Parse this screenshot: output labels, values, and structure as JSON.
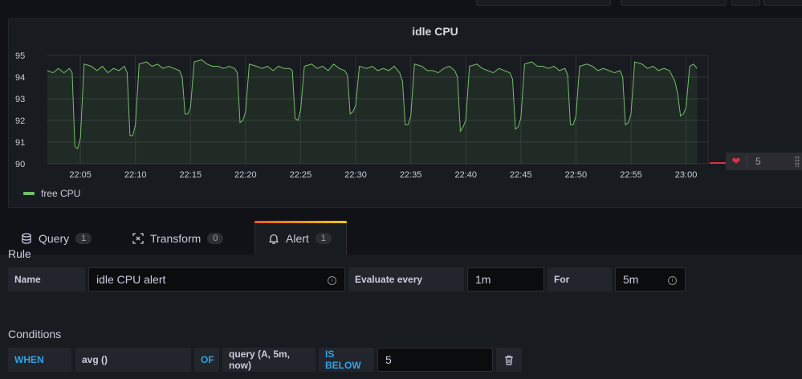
{
  "panel": {
    "title": "idle CPU",
    "legend_label": "free CPU",
    "threshold_value": "5"
  },
  "chart_data": {
    "type": "line",
    "title": "idle CPU",
    "xlabel": "",
    "ylabel": "",
    "ylim": [
      90,
      95
    ],
    "y_ticks": [
      "95",
      "94",
      "93",
      "92",
      "91",
      "90"
    ],
    "x_ticks": [
      "22:05",
      "22:10",
      "22:15",
      "22:20",
      "22:25",
      "22:30",
      "22:35",
      "22:40",
      "22:45",
      "22:50",
      "22:55",
      "23:00"
    ],
    "grid": true,
    "legend_position": "bottom-left",
    "series": [
      {
        "name": "free CPU",
        "color": "#73bf69",
        "points": [
          [
            "22:02",
            94.3
          ],
          [
            "22:02:30",
            94.2
          ],
          [
            "22:03",
            94.4
          ],
          [
            "22:03:30",
            94.2
          ],
          [
            "22:04",
            94.4
          ],
          [
            "22:04:15",
            94.2
          ],
          [
            "22:04:30",
            90.8
          ],
          [
            "22:04:45",
            90.7
          ],
          [
            "22:05",
            91.2
          ],
          [
            "22:05:20",
            94.6
          ],
          [
            "22:06",
            94.5
          ],
          [
            "22:06:30",
            94.3
          ],
          [
            "22:07",
            94.5
          ],
          [
            "22:07:30",
            94.2
          ],
          [
            "22:08",
            94.4
          ],
          [
            "22:08:30",
            94.3
          ],
          [
            "22:09",
            94.5
          ],
          [
            "22:09:15",
            94.2
          ],
          [
            "22:09:30",
            91.3
          ],
          [
            "22:09:45",
            91.3
          ],
          [
            "22:10",
            91.8
          ],
          [
            "22:10:20",
            94.6
          ],
          [
            "22:11",
            94.7
          ],
          [
            "22:11:30",
            94.5
          ],
          [
            "22:12",
            94.6
          ],
          [
            "22:12:30",
            94.4
          ],
          [
            "22:13",
            94.5
          ],
          [
            "22:13:30",
            94.4
          ],
          [
            "22:14",
            94.3
          ],
          [
            "22:14:15",
            94.0
          ],
          [
            "22:14:30",
            92.3
          ],
          [
            "22:14:45",
            92.3
          ],
          [
            "22:15",
            92.6
          ],
          [
            "22:15:20",
            94.7
          ],
          [
            "22:16",
            94.8
          ],
          [
            "22:16:30",
            94.6
          ],
          [
            "22:17",
            94.5
          ],
          [
            "22:17:30",
            94.5
          ],
          [
            "22:18",
            94.4
          ],
          [
            "22:18:30",
            94.5
          ],
          [
            "22:19",
            94.4
          ],
          [
            "22:19:15",
            94.2
          ],
          [
            "22:19:30",
            91.9
          ],
          [
            "22:19:45",
            92.0
          ],
          [
            "22:20",
            92.4
          ],
          [
            "22:20:20",
            94.6
          ],
          [
            "22:21",
            94.5
          ],
          [
            "22:21:30",
            94.4
          ],
          [
            "22:22",
            94.5
          ],
          [
            "22:22:30",
            94.3
          ],
          [
            "22:23",
            94.5
          ],
          [
            "22:23:30",
            94.4
          ],
          [
            "22:24",
            94.4
          ],
          [
            "22:24:15",
            94.3
          ],
          [
            "22:24:30",
            92.1
          ],
          [
            "22:24:45",
            92.0
          ],
          [
            "22:25",
            92.5
          ],
          [
            "22:25:20",
            94.5
          ],
          [
            "22:26",
            94.6
          ],
          [
            "22:26:30",
            94.4
          ],
          [
            "22:27",
            94.5
          ],
          [
            "22:27:30",
            94.3
          ],
          [
            "22:28",
            94.6
          ],
          [
            "22:28:30",
            94.4
          ],
          [
            "22:29",
            94.3
          ],
          [
            "22:29:15",
            94.1
          ],
          [
            "22:29:30",
            92.3
          ],
          [
            "22:29:45",
            92.4
          ],
          [
            "22:30",
            92.7
          ],
          [
            "22:30:20",
            94.5
          ],
          [
            "22:31",
            94.4
          ],
          [
            "22:31:30",
            94.5
          ],
          [
            "22:32",
            94.3
          ],
          [
            "22:32:30",
            94.4
          ],
          [
            "22:33",
            94.3
          ],
          [
            "22:33:30",
            94.5
          ],
          [
            "22:34",
            94.2
          ],
          [
            "22:34:15",
            93.8
          ],
          [
            "22:34:30",
            91.8
          ],
          [
            "22:34:45",
            91.8
          ],
          [
            "22:35",
            92.2
          ],
          [
            "22:35:20",
            94.6
          ],
          [
            "22:36",
            94.5
          ],
          [
            "22:36:30",
            94.3
          ],
          [
            "22:37",
            94.3
          ],
          [
            "22:37:30",
            94.2
          ],
          [
            "22:38",
            94.4
          ],
          [
            "22:38:30",
            94.5
          ],
          [
            "22:39",
            94.3
          ],
          [
            "22:39:15",
            94.0
          ],
          [
            "22:39:30",
            91.5
          ],
          [
            "22:39:45",
            91.7
          ],
          [
            "22:40",
            92.0
          ],
          [
            "22:40:20",
            94.5
          ],
          [
            "22:41",
            94.6
          ],
          [
            "22:41:30",
            94.4
          ],
          [
            "22:42",
            94.3
          ],
          [
            "22:42:30",
            94.2
          ],
          [
            "22:43",
            94.4
          ],
          [
            "22:43:30",
            94.3
          ],
          [
            "22:44",
            94.2
          ],
          [
            "22:44:15",
            93.9
          ],
          [
            "22:44:30",
            91.6
          ],
          [
            "22:44:45",
            91.7
          ],
          [
            "22:45",
            92.1
          ],
          [
            "22:45:20",
            94.6
          ],
          [
            "22:46",
            94.7
          ],
          [
            "22:46:30",
            94.5
          ],
          [
            "22:47",
            94.5
          ],
          [
            "22:47:30",
            94.4
          ],
          [
            "22:48",
            94.5
          ],
          [
            "22:48:30",
            94.3
          ],
          [
            "22:49",
            94.4
          ],
          [
            "22:49:15",
            94.1
          ],
          [
            "22:49:30",
            91.8
          ],
          [
            "22:49:45",
            91.8
          ],
          [
            "22:50",
            92.2
          ],
          [
            "22:50:20",
            94.5
          ],
          [
            "22:51",
            94.6
          ],
          [
            "22:51:30",
            94.5
          ],
          [
            "22:52",
            94.3
          ],
          [
            "22:52:30",
            94.4
          ],
          [
            "22:53",
            94.3
          ],
          [
            "22:53:30",
            94.2
          ],
          [
            "22:54",
            94.3
          ],
          [
            "22:54:15",
            94.0
          ],
          [
            "22:54:30",
            91.8
          ],
          [
            "22:54:45",
            91.9
          ],
          [
            "22:55",
            92.3
          ],
          [
            "22:55:20",
            94.7
          ],
          [
            "22:56",
            94.6
          ],
          [
            "22:56:30",
            94.4
          ],
          [
            "22:57",
            94.5
          ],
          [
            "22:57:30",
            94.3
          ],
          [
            "22:58",
            94.4
          ],
          [
            "22:58:30",
            94.3
          ],
          [
            "22:59",
            93.8
          ],
          [
            "22:59:15",
            93.2
          ],
          [
            "22:59:30",
            92.2
          ],
          [
            "22:59:45",
            92.3
          ],
          [
            "23:00",
            92.6
          ],
          [
            "23:00:20",
            94.5
          ],
          [
            "23:00:40",
            94.6
          ],
          [
            "23:01",
            94.4
          ]
        ]
      }
    ]
  },
  "tabs": [
    {
      "icon": "database-icon",
      "label": "Query",
      "count": "1"
    },
    {
      "icon": "transform-icon",
      "label": "Transform",
      "count": "0"
    },
    {
      "icon": "bell-icon",
      "label": "Alert",
      "count": "1"
    }
  ],
  "rule": {
    "section_title": "Rule",
    "name_label": "Name",
    "name_value": "idle CPU alert",
    "evaluate_label": "Evaluate every",
    "evaluate_value": "1m",
    "for_label": "For",
    "for_value": "5m"
  },
  "conditions": {
    "section_title": "Conditions",
    "when": "WHEN",
    "reducer": "avg ()",
    "of": "OF",
    "query": "query (A, 5m, now)",
    "evaluator": "IS BELOW",
    "threshold": "5"
  }
}
